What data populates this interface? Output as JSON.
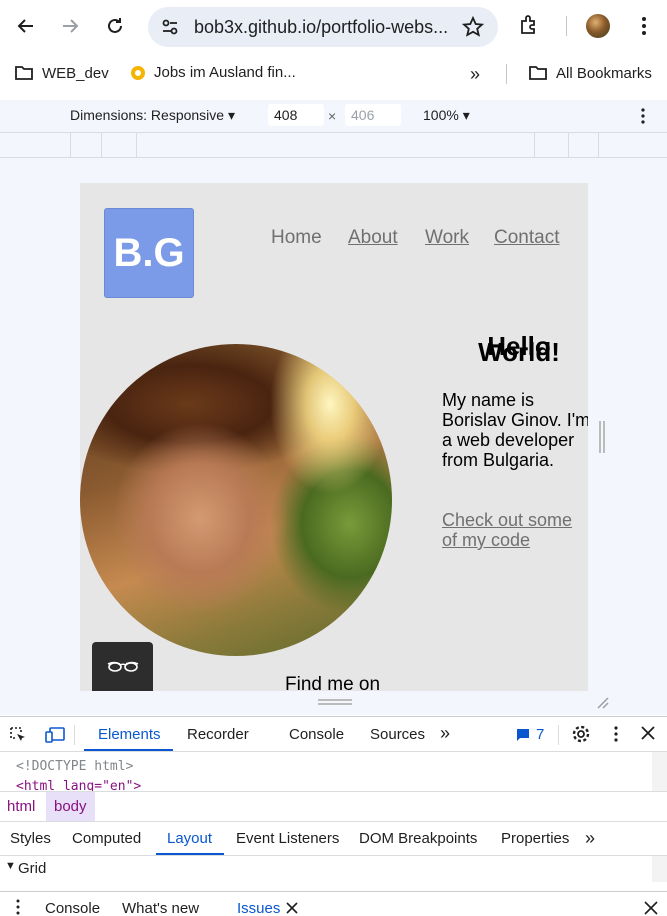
{
  "browser": {
    "url": "bob3x.github.io/portfolio-webs...",
    "bookmarks": [
      {
        "label": "WEB_dev",
        "icon": "folder-icon"
      },
      {
        "label": "Jobs im Ausland fin...",
        "icon": "favicon-icon"
      }
    ],
    "all_bookmarks": "All Bookmarks",
    "overflow": "»"
  },
  "device_toolbar": {
    "dimensions_label": "Dimensions: Responsive",
    "width": "408",
    "height_placeholder": "406",
    "times": "×",
    "zoom": "100%"
  },
  "site": {
    "logo": "B.G",
    "nav": [
      "Home",
      "About",
      "Work",
      "Contact"
    ],
    "hello_line1": "Hello",
    "hello_line2": "World!",
    "intro": "My name is Borislav Ginov. I'm a web developer from Bulgaria.",
    "cta": "Check out some of my code",
    "find_me": "Find me on"
  },
  "devtools": {
    "tabs": [
      "Elements",
      "Recorder",
      "Console",
      "Sources"
    ],
    "issues_count": "7",
    "code_line1": "<!DOCTYPE html>",
    "code_line2": "<html lang=\"en\">",
    "breadcrumbs": [
      "html",
      "body"
    ],
    "sub_tabs": [
      "Styles",
      "Computed",
      "Layout",
      "Event Listeners",
      "DOM Breakpoints",
      "Properties"
    ],
    "grid_label": "Grid",
    "drawer_tabs": [
      "Console",
      "What's new",
      "Issues"
    ]
  },
  "colors": {
    "logo_bg": "#7b9be8",
    "accent": "#0b57d0",
    "page_bg": "#e6e6e6"
  }
}
